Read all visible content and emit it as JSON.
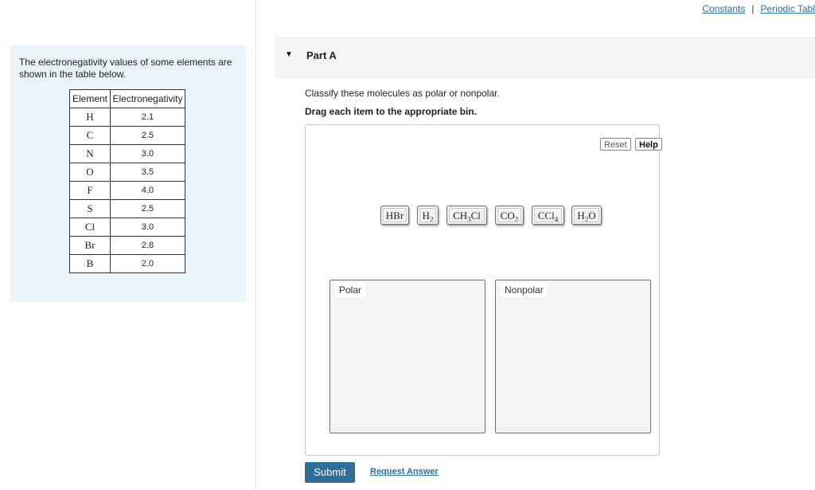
{
  "top_links": {
    "constants": "Constants",
    "separator": "|",
    "periodic": "Periodic Tabl"
  },
  "info": {
    "text": "The electronegativity values of some elements are shown in the table below.",
    "table": {
      "headers": [
        "Element",
        "Electronegativity"
      ],
      "rows": [
        [
          "H",
          "2.1"
        ],
        [
          "C",
          "2.5"
        ],
        [
          "N",
          "3.0"
        ],
        [
          "O",
          "3.5"
        ],
        [
          "F",
          "4.0"
        ],
        [
          "S",
          "2.5"
        ],
        [
          "Cl",
          "3.0"
        ],
        [
          "Br",
          "2.8"
        ],
        [
          "B",
          "2.0"
        ]
      ]
    }
  },
  "part": {
    "title": "Part A",
    "caret_icon": "triangle-down-icon"
  },
  "question": "Classify these molecules as polar or nonpolar.",
  "instruction": "Drag each item to the appropriate bin.",
  "controls": {
    "reset": "Reset",
    "help": "Help"
  },
  "molecules": [
    "HBr",
    "H2",
    "CH3Cl",
    "CO2",
    "CCl4",
    "H2O"
  ],
  "bins": {
    "polar": "Polar",
    "nonpolar": "Nonpolar"
  },
  "footer": {
    "submit": "Submit",
    "request_answer": "Request Answer"
  },
  "colors": {
    "submit_bg": "#2f6e99",
    "link": "#2b6ea6",
    "info_bg": "#e8f4f7"
  }
}
